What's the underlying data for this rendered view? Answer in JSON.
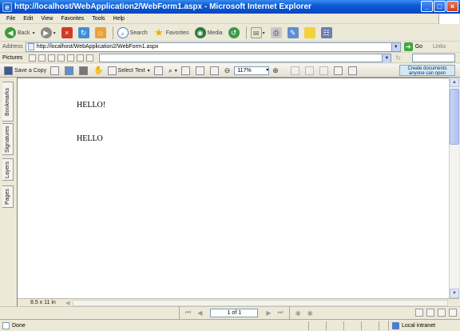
{
  "window": {
    "title": "http://localhost/WebApplication2/WebForm1.aspx - Microsoft Internet Explorer",
    "icon": "ie-icon"
  },
  "menu": [
    "File",
    "Edit",
    "View",
    "Favorites",
    "Tools",
    "Help"
  ],
  "toolbar": {
    "back_label": "Back",
    "search_label": "Search",
    "favorites_label": "Favorites",
    "media_label": "Media"
  },
  "address": {
    "label": "Address",
    "value": "http://localhost/WebApplication2/WebForm1.aspx",
    "go_label": "Go",
    "links_label": "Links"
  },
  "pictures": {
    "label": "Pictures"
  },
  "acrobat": {
    "save_label": "Save a Copy",
    "select_text_label": "Select Text",
    "zoom_value": "117%",
    "create_line1": "Create documents",
    "create_line2": "anyone can open"
  },
  "sidetabs": [
    "Bookmarks",
    "Signatures",
    "Layers",
    "Pages"
  ],
  "document": {
    "line1": "HELLO!",
    "line2": "HELLO"
  },
  "footer": {
    "page_size": "8.5 x 11 in",
    "page_indicator": "1 of 1"
  },
  "status": {
    "text": "Done",
    "zone": "Local intranet"
  }
}
